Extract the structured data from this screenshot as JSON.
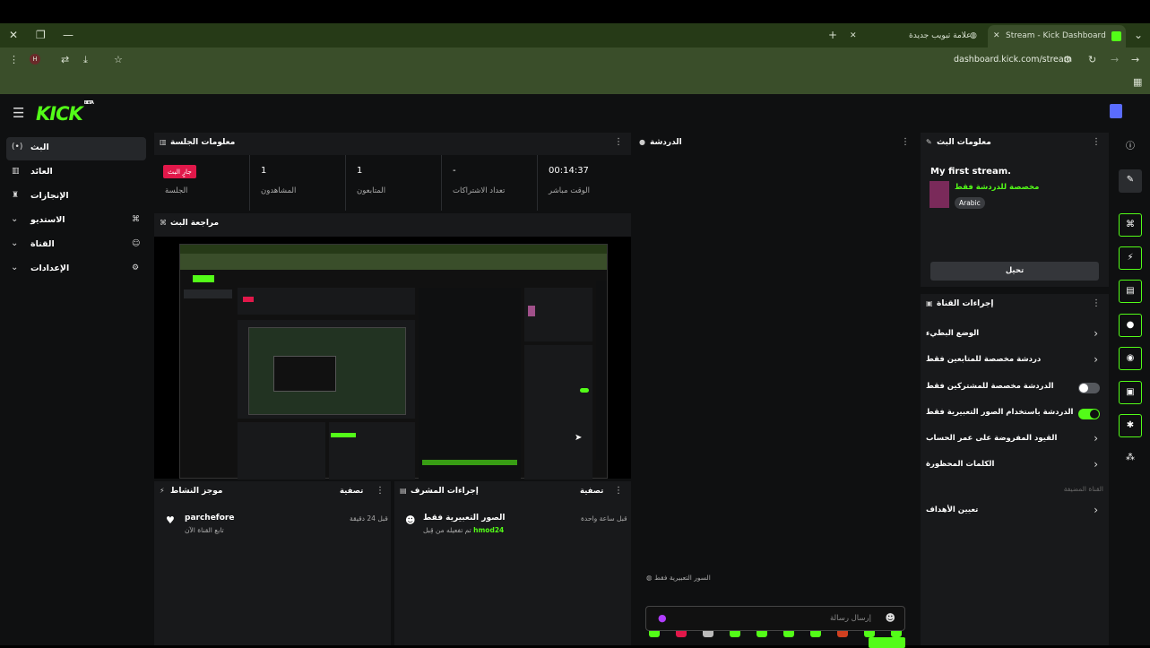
{
  "browser": {
    "tabs": [
      {
        "label": "Stream - Kick Dashboard",
        "active": true
      },
      {
        "label": "علامة تبويب جديدة",
        "active": false
      }
    ],
    "url": "dashboard.kick.com/stream"
  },
  "app": {
    "logo": "KICK",
    "logo_badge": "BETA"
  },
  "sidebar": {
    "items": [
      {
        "label": "البث",
        "active": true
      },
      {
        "label": "العائد"
      },
      {
        "label": "الإنجازات"
      },
      {
        "label": "الاستديو"
      },
      {
        "label": "القناة"
      },
      {
        "label": "الإعدادات"
      }
    ]
  },
  "session": {
    "title": "معلومات الجلسة",
    "live_badge": "جارٍ البث",
    "session_label": "الجلسة",
    "viewers_value": "1",
    "viewers_label": "المشاهدون",
    "followers_value": "1",
    "followers_label": "المتابعون",
    "subs_value": "-",
    "subs_label": "تعداد الاشتراكات",
    "time_value": "00:14:37",
    "time_label": "الوقت مباشر"
  },
  "preview": {
    "title": "مراجعة البث"
  },
  "chat": {
    "title": "الدردشة",
    "emote_only_notice": "السور التعبيرية فقط",
    "placeholder": "إرسال رسالة"
  },
  "stream_info": {
    "title": "معلومات البث",
    "stream_title": "My first stream.",
    "category": "مخصصة للدردشة فقط",
    "language": "Arabic",
    "edit_button": "تحيل"
  },
  "channel_actions": {
    "title": "إجراءات القناة",
    "rows": [
      {
        "label": "الوضع البطيء",
        "type": "chevron"
      },
      {
        "label": "دردشة مخصصة للمتابعين فقط",
        "type": "chevron"
      },
      {
        "label": "الدردشة مخصصة للمشتركين فقط",
        "type": "toggle",
        "on": false
      },
      {
        "label": "الدردشة باستخدام الصور التعبيرية فقط",
        "type": "toggle",
        "on": true
      },
      {
        "label": "القيود المفروضة على عمر الحساب",
        "type": "chevron"
      },
      {
        "label": "الكلمات المحظورة",
        "type": "chevron"
      }
    ],
    "hosted_label": "القناة المضيفة",
    "goals_label": "تعيين الأهداف"
  },
  "activity": {
    "title": "موجز النشاط",
    "filter": "تصفية",
    "event_name": "parchefore",
    "event_sub": "تابع القناة الآن",
    "event_time": "قبل 24 دقيقة"
  },
  "mod": {
    "title": "إجراءات المشرف",
    "filter": "تصفية",
    "event_name": "الصور التعبيرية فقط",
    "event_sub_prefix": "تم تفعيله من قِبل",
    "event_user": "hmod24",
    "event_time": "قبل ساعة واحدة"
  },
  "colors": {
    "accent": "#53fc18",
    "live": "#e1184a"
  }
}
